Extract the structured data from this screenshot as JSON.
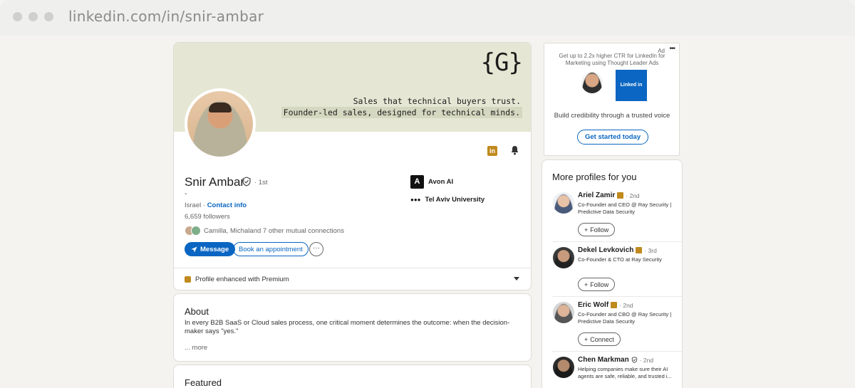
{
  "browser": {
    "url": "linkedin.com/in/snir-ambar"
  },
  "banner": {
    "logo": "{G}",
    "line1": "Sales that technical buyers trust.",
    "line2": "Founder-led sales, designed for technical minds."
  },
  "profile": {
    "name": "Snir Ambar",
    "degree": "· 1st",
    "headline": "-",
    "location": "Israel",
    "contact_link": "Contact info",
    "followers": "6,659 followers",
    "mutual_names": "Camilla, Michal",
    "mutual_rest": " and 7 other mutual connections",
    "message_label": "Message",
    "book_label": "Book an appointment",
    "more_label": "···",
    "experience": [
      {
        "name": "Avon AI",
        "logo": "A"
      },
      {
        "name": "Tel Aviv University",
        "logo": "●●●"
      }
    ],
    "premium_label": "Profile enhanced with Premium"
  },
  "about": {
    "heading": "About",
    "text": "In every B2B SaaS or Cloud sales process, one critical moment determines the outcome: when the decision-maker says \"yes.\"",
    "more": "... more"
  },
  "featured": {
    "heading": "Featured"
  },
  "ad": {
    "label": "Ad",
    "menu": "•••",
    "copy": "Get up to 2.2x higher CTR for LinkedIn for Marketing using Thought Leader Ads",
    "brand": "Linked in Ads",
    "headline": "Build credibility through a trusted voice",
    "cta": "Get started today"
  },
  "more_profiles": {
    "heading": "More profiles for you",
    "people": [
      {
        "name": "Ariel Zamir",
        "degree": "· 2nd",
        "title": "Co-Founder and CEO @ Ray Security | Predictive Data Security",
        "action": "Follow",
        "action_icon": "+"
      },
      {
        "name": "Dekel Levkovich",
        "degree": "· 3rd",
        "title": "Co-Founder & CTO at Ray Security",
        "action": "Follow",
        "action_icon": "+"
      },
      {
        "name": "Eric Wolf",
        "degree": "· 2nd",
        "title": "Co-Founder and CBO @ Ray Security | Predictive Data Security",
        "action": "Connect",
        "action_icon": "+"
      },
      {
        "name": "Chen Markman",
        "degree": "· 2nd",
        "title": "Helping companies make sure their AI agents are safe, reliable, and trusted i...",
        "action": "",
        "action_icon": ""
      }
    ]
  },
  "colors": {
    "accent": "#0a66c2",
    "premium": "#c08a1e",
    "banner_bg": "#e5e7d4"
  }
}
